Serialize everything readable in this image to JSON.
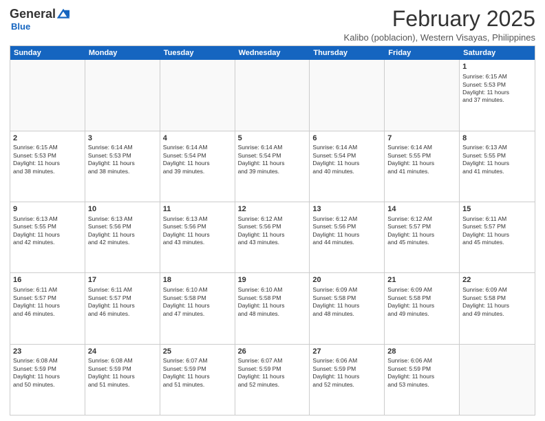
{
  "logo": {
    "general": "General",
    "blue": "Blue",
    "tagline": "Blue"
  },
  "header": {
    "title": "February 2025",
    "subtitle": "Kalibo (poblacion), Western Visayas, Philippines"
  },
  "dayHeaders": [
    "Sunday",
    "Monday",
    "Tuesday",
    "Wednesday",
    "Thursday",
    "Friday",
    "Saturday"
  ],
  "weeks": [
    [
      {
        "day": "",
        "info": ""
      },
      {
        "day": "",
        "info": ""
      },
      {
        "day": "",
        "info": ""
      },
      {
        "day": "",
        "info": ""
      },
      {
        "day": "",
        "info": ""
      },
      {
        "day": "",
        "info": ""
      },
      {
        "day": "1",
        "info": "Sunrise: 6:15 AM\nSunset: 5:53 PM\nDaylight: 11 hours\nand 37 minutes."
      }
    ],
    [
      {
        "day": "2",
        "info": "Sunrise: 6:15 AM\nSunset: 5:53 PM\nDaylight: 11 hours\nand 38 minutes."
      },
      {
        "day": "3",
        "info": "Sunrise: 6:14 AM\nSunset: 5:53 PM\nDaylight: 11 hours\nand 38 minutes."
      },
      {
        "day": "4",
        "info": "Sunrise: 6:14 AM\nSunset: 5:54 PM\nDaylight: 11 hours\nand 39 minutes."
      },
      {
        "day": "5",
        "info": "Sunrise: 6:14 AM\nSunset: 5:54 PM\nDaylight: 11 hours\nand 39 minutes."
      },
      {
        "day": "6",
        "info": "Sunrise: 6:14 AM\nSunset: 5:54 PM\nDaylight: 11 hours\nand 40 minutes."
      },
      {
        "day": "7",
        "info": "Sunrise: 6:14 AM\nSunset: 5:55 PM\nDaylight: 11 hours\nand 41 minutes."
      },
      {
        "day": "8",
        "info": "Sunrise: 6:13 AM\nSunset: 5:55 PM\nDaylight: 11 hours\nand 41 minutes."
      }
    ],
    [
      {
        "day": "9",
        "info": "Sunrise: 6:13 AM\nSunset: 5:55 PM\nDaylight: 11 hours\nand 42 minutes."
      },
      {
        "day": "10",
        "info": "Sunrise: 6:13 AM\nSunset: 5:56 PM\nDaylight: 11 hours\nand 42 minutes."
      },
      {
        "day": "11",
        "info": "Sunrise: 6:13 AM\nSunset: 5:56 PM\nDaylight: 11 hours\nand 43 minutes."
      },
      {
        "day": "12",
        "info": "Sunrise: 6:12 AM\nSunset: 5:56 PM\nDaylight: 11 hours\nand 43 minutes."
      },
      {
        "day": "13",
        "info": "Sunrise: 6:12 AM\nSunset: 5:56 PM\nDaylight: 11 hours\nand 44 minutes."
      },
      {
        "day": "14",
        "info": "Sunrise: 6:12 AM\nSunset: 5:57 PM\nDaylight: 11 hours\nand 45 minutes."
      },
      {
        "day": "15",
        "info": "Sunrise: 6:11 AM\nSunset: 5:57 PM\nDaylight: 11 hours\nand 45 minutes."
      }
    ],
    [
      {
        "day": "16",
        "info": "Sunrise: 6:11 AM\nSunset: 5:57 PM\nDaylight: 11 hours\nand 46 minutes."
      },
      {
        "day": "17",
        "info": "Sunrise: 6:11 AM\nSunset: 5:57 PM\nDaylight: 11 hours\nand 46 minutes."
      },
      {
        "day": "18",
        "info": "Sunrise: 6:10 AM\nSunset: 5:58 PM\nDaylight: 11 hours\nand 47 minutes."
      },
      {
        "day": "19",
        "info": "Sunrise: 6:10 AM\nSunset: 5:58 PM\nDaylight: 11 hours\nand 48 minutes."
      },
      {
        "day": "20",
        "info": "Sunrise: 6:09 AM\nSunset: 5:58 PM\nDaylight: 11 hours\nand 48 minutes."
      },
      {
        "day": "21",
        "info": "Sunrise: 6:09 AM\nSunset: 5:58 PM\nDaylight: 11 hours\nand 49 minutes."
      },
      {
        "day": "22",
        "info": "Sunrise: 6:09 AM\nSunset: 5:58 PM\nDaylight: 11 hours\nand 49 minutes."
      }
    ],
    [
      {
        "day": "23",
        "info": "Sunrise: 6:08 AM\nSunset: 5:59 PM\nDaylight: 11 hours\nand 50 minutes."
      },
      {
        "day": "24",
        "info": "Sunrise: 6:08 AM\nSunset: 5:59 PM\nDaylight: 11 hours\nand 51 minutes."
      },
      {
        "day": "25",
        "info": "Sunrise: 6:07 AM\nSunset: 5:59 PM\nDaylight: 11 hours\nand 51 minutes."
      },
      {
        "day": "26",
        "info": "Sunrise: 6:07 AM\nSunset: 5:59 PM\nDaylight: 11 hours\nand 52 minutes."
      },
      {
        "day": "27",
        "info": "Sunrise: 6:06 AM\nSunset: 5:59 PM\nDaylight: 11 hours\nand 52 minutes."
      },
      {
        "day": "28",
        "info": "Sunrise: 6:06 AM\nSunset: 5:59 PM\nDaylight: 11 hours\nand 53 minutes."
      },
      {
        "day": "",
        "info": ""
      }
    ]
  ]
}
